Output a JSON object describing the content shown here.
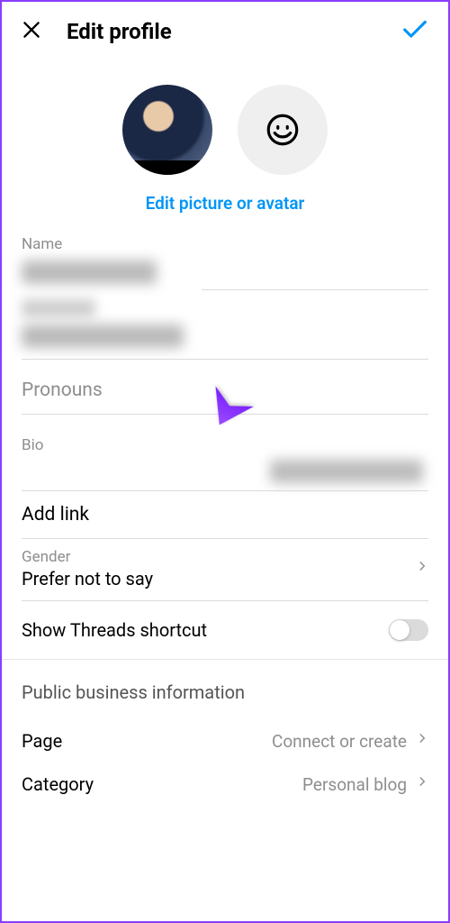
{
  "header": {
    "title": "Edit profile"
  },
  "edit_link": "Edit picture or avatar",
  "labels": {
    "name": "Name",
    "pronouns": "Pronouns",
    "bio": "Bio",
    "add_link": "Add link",
    "gender": "Gender",
    "threads": "Show Threads shortcut",
    "public_business": "Public business information",
    "page": "Page",
    "category": "Category"
  },
  "values": {
    "gender": "Prefer not to say",
    "page": "Connect or create",
    "category": "Personal blog"
  }
}
